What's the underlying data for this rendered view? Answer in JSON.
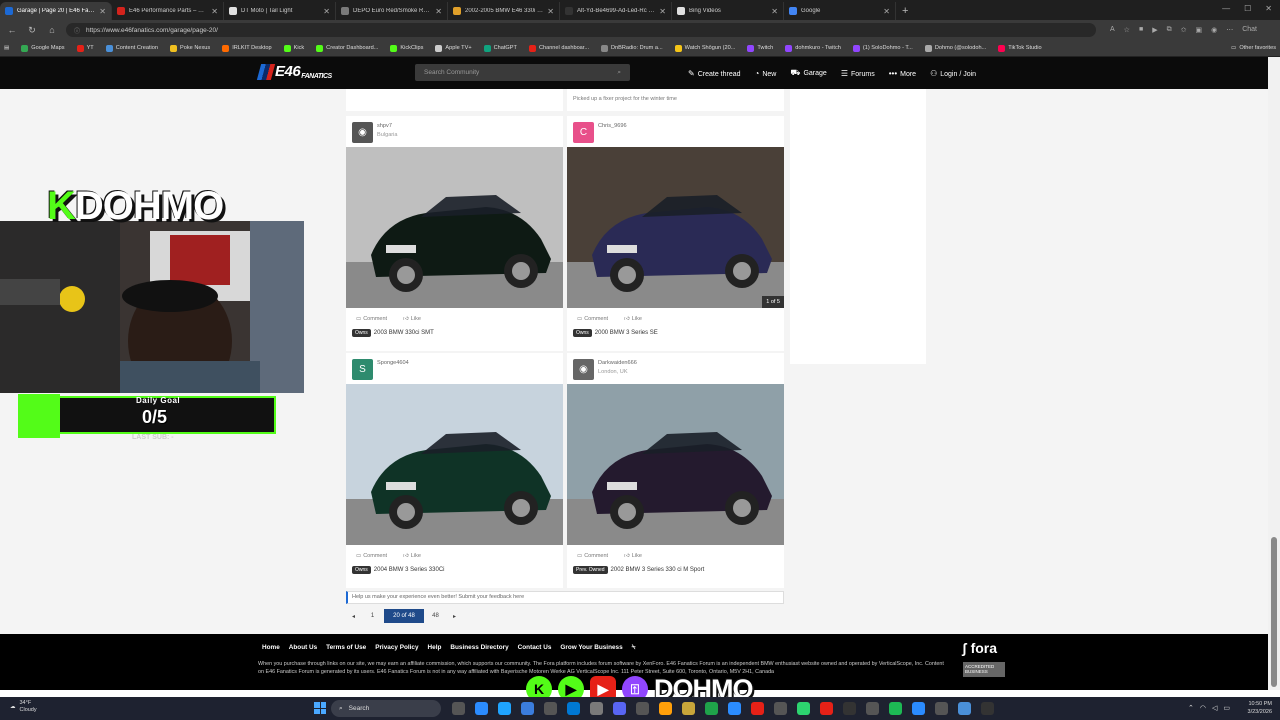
{
  "browser": {
    "tabs": [
      {
        "label": "Garage | Page 20 | E46 Fanatics Forum",
        "color": "#1c69d4",
        "active": true
      },
      {
        "label": "E46 Performance Parts – Garagistic",
        "color": "#d4231c",
        "active": false
      },
      {
        "label": "DT Moto | Tail Light",
        "color": "#e0e0e0",
        "active": false
      },
      {
        "label": "DEPO Euro Red/Smoke Rear Tail Lights",
        "color": "#7a7a7a",
        "active": false
      },
      {
        "label": "2002-2005 BMW E46 330i 325i 330",
        "color": "#e0a02a",
        "active": false
      },
      {
        "label": "Alt-Yd-Be4699-Ad-Led-Rc for sale",
        "color": "#333",
        "active": false
      },
      {
        "label": "Bing Videos",
        "color": "#e0e0e0",
        "active": false
      },
      {
        "label": "Google",
        "color": "#4285f4",
        "active": false
      }
    ],
    "url": "https://www.e46fanatics.com/garage/page-20/",
    "chat_label": "Chat",
    "bookmarks": [
      {
        "label": "Google Maps",
        "color": "#34a853"
      },
      {
        "label": "YT",
        "color": "#e62117"
      },
      {
        "label": "Content Creation",
        "color": "#4a90d9"
      },
      {
        "label": "Poke Nexus",
        "color": "#f0c020"
      },
      {
        "label": "IRLKIT Desktop",
        "color": "#ff6a00"
      },
      {
        "label": "Kick",
        "color": "#53fc18"
      },
      {
        "label": "Creator Dashboard...",
        "color": "#53fc18"
      },
      {
        "label": "KickClips",
        "color": "#53fc18"
      },
      {
        "label": "Apple TV+",
        "color": "#cccccc"
      },
      {
        "label": "ChatGPT",
        "color": "#10a37f"
      },
      {
        "label": "Channel dashboar...",
        "color": "#e62117"
      },
      {
        "label": "DnBRadio: Drum a...",
        "color": "#888888"
      },
      {
        "label": "Watch Shōgun (20...",
        "color": "#f5c518"
      },
      {
        "label": "Twitch",
        "color": "#9146ff"
      },
      {
        "label": "dohmkuro - Twitch",
        "color": "#9146ff"
      },
      {
        "label": "(1) SoloDohmo - T...",
        "color": "#9146ff"
      },
      {
        "label": "Dohmo (@solodoh...",
        "color": "#aaaaaa"
      },
      {
        "label": "TikTok Studio",
        "color": "#ff0050"
      }
    ],
    "other_favorites": "Other favorites"
  },
  "header": {
    "logo_text": "E46",
    "logo_sub": "FANATICS",
    "search_placeholder": "Search Community",
    "nav": [
      {
        "label": "Create thread",
        "icon": "edit-icon",
        "glyph": "✎"
      },
      {
        "label": "New",
        "icon": "clock-icon",
        "glyph": "◔"
      },
      {
        "label": "Garage",
        "icon": "car-icon",
        "glyph": "⛟"
      },
      {
        "label": "Forums",
        "icon": "list-icon",
        "glyph": "☰"
      },
      {
        "label": "More",
        "icon": "more-icon",
        "glyph": "•••"
      },
      {
        "label": "Login / Join",
        "icon": "user-icon",
        "glyph": "⚇"
      }
    ]
  },
  "top_strip_text": "Picked up a fixer project for the winter time",
  "cards": [
    {
      "username": "shpv7",
      "location": "Bulgaria",
      "avatar_letter": "",
      "avatar_color": "#555555",
      "car_color": "#0e1a14",
      "bg": "#bfbfbf",
      "pill": "Owns",
      "title": "2003 BMW 330ci SMT",
      "comment": "Comment",
      "like": "Like",
      "count_badge": ""
    },
    {
      "username": "Chris_9696",
      "location": "",
      "avatar_letter": "C",
      "avatar_color": "#e8508a",
      "car_color": "#2a2a55",
      "bg": "#4a4038",
      "pill": "Owns",
      "title": "2000 BMW 3 Series SE",
      "comment": "Comment",
      "like": "Like",
      "count_badge": "1 of 5"
    },
    {
      "username": "Sponge4604",
      "location": "",
      "avatar_letter": "S",
      "avatar_color": "#2e8b6e",
      "car_color": "#0f3326",
      "bg": "#c7d3dd",
      "pill": "Owns",
      "title": "2004 BMW 3 Series 330Ci",
      "comment": "Comment",
      "like": "Like",
      "count_badge": ""
    },
    {
      "username": "Darkwaiden666",
      "location": "London, UK",
      "avatar_letter": "",
      "avatar_color": "#666666",
      "car_color": "#241a2e",
      "bg": "#8fa0a8",
      "pill": "Prev. Owned",
      "title": "2002 BMW 3 Series 330 ci M Sport",
      "comment": "Comment",
      "like": "Like",
      "count_badge": ""
    }
  ],
  "feedback": "Help us make your experience even better! Submit your feedback here",
  "pagination": {
    "prev": "◂",
    "first": "1",
    "current": "20 of 48",
    "last": "48",
    "next": "▸"
  },
  "footer": {
    "links": [
      "Home",
      "About Us",
      "Terms of Use",
      "Privacy Policy",
      "Help",
      "Business Directory",
      "Contact Us",
      "Grow Your Business",
      "⍀"
    ],
    "text": "When you purchase through links on our site, we may earn an affiliate commission, which supports our community. The Fora platform includes forum software by XenForo. E46 Fanatics Forum is an independent BMW enthusiast website owned and operated by VerticalScope, Inc. Content on E46 Fanatics Forum is generated by its users. E46 Fanatics Forum is not in any way affiliated with Bayerische Motoren Werke AG VerticalScope Inc. 111 Peter Street, Suite 600, Toronto, Ontario, M5V 2H1, Canada",
    "brand": "fora",
    "accredited": "ACCREDITED BUSINESS"
  },
  "overlay": {
    "name_k": "K",
    "name": "DOHMO",
    "goal_label": "Daily Goal",
    "goal_value": "0/5",
    "last_sub": "LAST SUB: -",
    "handle": "DOHMO"
  },
  "taskbar": {
    "temp": "34°F",
    "weather": "Cloudy",
    "search": "Search",
    "time": "10:50 PM",
    "date": "3/23/2026",
    "app_colors": [
      "#555",
      "#2b8cff",
      "#1fa4ff",
      "#3b7ddd",
      "#555",
      "#0078d4",
      "#7a7a7a",
      "#5865f2",
      "#555",
      "#ff9f0a",
      "#c8a63a",
      "#1fa34a",
      "#2b8cff",
      "#e62117",
      "#555",
      "#2dd36f",
      "#e62117",
      "#333",
      "#555",
      "#1db954",
      "#2b8cff",
      "#555",
      "#4a90d9",
      "#333"
    ]
  }
}
